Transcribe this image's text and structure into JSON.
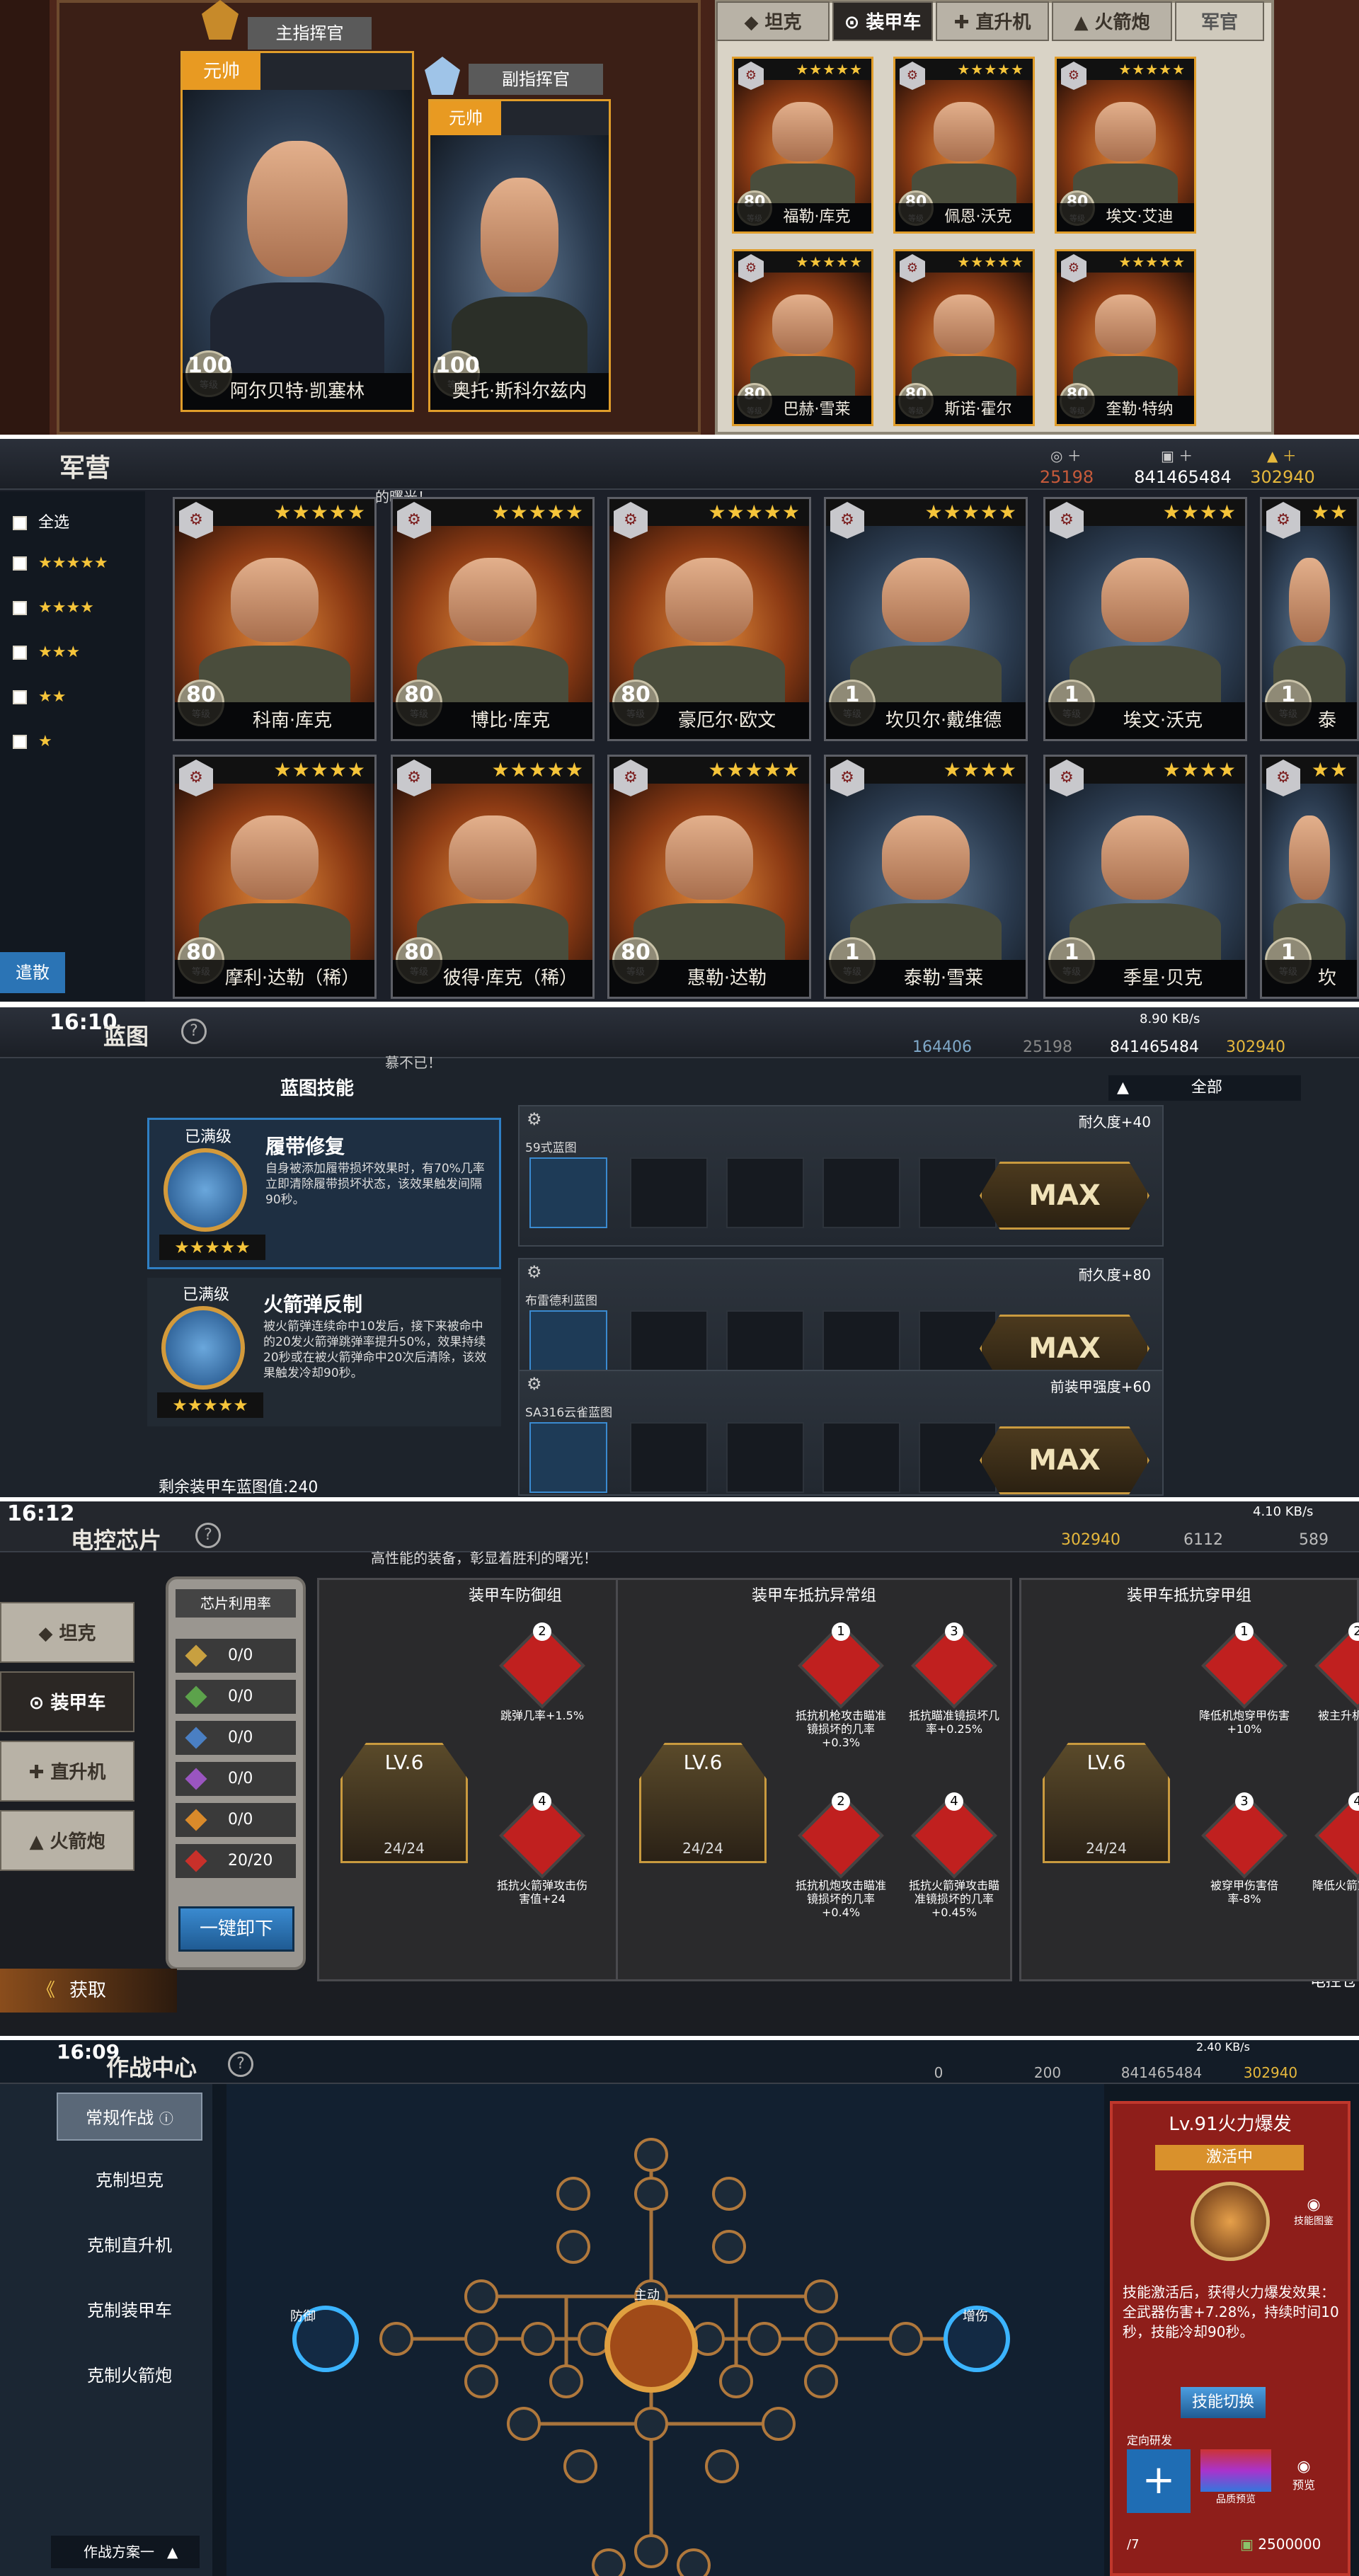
{
  "panel1": {
    "commander_label": "主指挥官",
    "vice_label": "副指挥官",
    "rank1": "元帅",
    "rank2": "元帅",
    "commander_name": "阿尔贝特·凯塞林",
    "vice_name": "奥托·斯科尔兹内",
    "commander_level": "100",
    "vice_level": "100",
    "level_unit": "等级",
    "tabs": [
      "坦克",
      "装甲车",
      "直升机",
      "火箭炮",
      "军官"
    ],
    "officers": [
      {
        "name": "福勒·库克",
        "level": "80"
      },
      {
        "name": "佩恩·沃克",
        "level": "80"
      },
      {
        "name": "埃文·艾迪",
        "level": "80"
      },
      {
        "name": "巴赫·雪莱",
        "level": "80"
      },
      {
        "name": "斯诺·霍尔",
        "level": "80"
      },
      {
        "name": "奎勒·特纳",
        "level": "80"
      }
    ]
  },
  "panel2": {
    "title": "军营",
    "res": [
      "25198",
      "841465484",
      "302940"
    ],
    "marquee": "…的曙光！",
    "filters": [
      "全选",
      "★★★★★",
      "★★★★",
      "★★★",
      "★★",
      "★"
    ],
    "dismiss": "遣散",
    "level_unit": "等级",
    "cards": [
      {
        "name": "科南·库克",
        "level": "80",
        "stars": "★★★★★"
      },
      {
        "name": "博比·库克",
        "level": "80",
        "stars": "★★★★★"
      },
      {
        "name": "豪厄尔·欧文",
        "level": "80",
        "stars": "★★★★★"
      },
      {
        "name": "坎贝尔·戴维德",
        "level": "1",
        "stars": "★★★★★"
      },
      {
        "name": "埃文·沃克",
        "level": "1",
        "stars": "★★★★"
      },
      {
        "name": "泰",
        "level": "1",
        "stars": "★★"
      },
      {
        "name": "摩利·达勒（稀）",
        "level": "80",
        "stars": "★★★★★"
      },
      {
        "name": "彼得·库克（稀）",
        "level": "80",
        "stars": "★★★★★"
      },
      {
        "name": "惠勒·达勒",
        "level": "80",
        "stars": "★★★★★"
      },
      {
        "name": "泰勒·雪莱",
        "level": "1",
        "stars": "★★★★"
      },
      {
        "name": "季星·贝克",
        "level": "1",
        "stars": "★★★★"
      },
      {
        "name": "坎",
        "level": "1",
        "stars": "★★"
      }
    ]
  },
  "panel3": {
    "time": "16:10",
    "title": "蓝图",
    "res": [
      "164406",
      "25198",
      "841465484",
      "302940"
    ],
    "net": "8.90 KB/s",
    "marquee": "慕不已！",
    "section": "蓝图技能",
    "filter_all": "全部",
    "skills": [
      {
        "status": "已满级",
        "name": "履带修复",
        "desc": "自身被添加履带损坏效果时，有70%几率立即清除履带损坏状态，该效果触发间隔90秒。",
        "stars": "★★★★★"
      },
      {
        "status": "已满级",
        "name": "火箭弹反制",
        "desc": "被火箭弹连续命中10发后，接下来被命中的20发火箭弹跳弹率提升50%，效果持续20秒或在被火箭弹命中20次后清除，该效果触发冷却90秒。",
        "stars": "★★★★★"
      }
    ],
    "remain": "剩余装甲车蓝图值:240",
    "rows": [
      {
        "bonus": "耐久度+40",
        "bp": "59式蓝图",
        "max": "MAX"
      },
      {
        "bonus": "耐久度+80",
        "bp": "布雷德利蓝图",
        "max": "MAX"
      },
      {
        "bonus": "前装甲强度+60",
        "bp": "SA316云雀蓝图",
        "max": "MAX"
      }
    ]
  },
  "panel4": {
    "time": "16:12",
    "title": "电控芯片",
    "res": [
      "302940",
      "6112",
      "589"
    ],
    "net": "4.10 KB/s",
    "marquee": "高性能的装备，彰显着胜利的曙光！",
    "side": [
      "坦克",
      "装甲车",
      "直升机",
      "火箭炮"
    ],
    "util_title": "芯片利用率",
    "util": [
      "0/0",
      "0/0",
      "0/0",
      "0/0",
      "0/0",
      "20/20"
    ],
    "unload": "一键卸下",
    "acquire": "获取",
    "warehouse": "电控仓",
    "groups": [
      {
        "title": "装甲车防御组",
        "lv": "LV.6",
        "count": "24/24",
        "nodes": [
          {
            "n": "2",
            "t": "跳弹几率+1.5%"
          },
          {
            "n": "4",
            "t": "抵抗火箭弹攻击伤害值+24"
          }
        ]
      },
      {
        "title": "装甲车抵抗异常组",
        "lv": "LV.6",
        "count": "24/24",
        "nodes": [
          {
            "n": "1",
            "t": "抵抗机枪攻击瞄准镜损坏的几率+0.3%"
          },
          {
            "n": "2",
            "t": "抵抗机炮攻击瞄准镜损坏的几率+0.4%"
          },
          {
            "n": "3",
            "t": "抵抗瞄准镜损坏几率+0.25%"
          },
          {
            "n": "4",
            "t": "抵抗火箭弹攻击瞄准镜损坏的几率+0.45%"
          }
        ]
      },
      {
        "title": "装甲车抵抗穿甲组",
        "lv": "LV.6",
        "count": "24/24",
        "nodes": [
          {
            "n": "1",
            "t": "降低机炮穿甲伤害+10%"
          },
          {
            "n": "3",
            "t": "被穿甲伤害倍率-8%"
          },
          {
            "n": "2",
            "t": "被主升机减伤率"
          },
          {
            "n": "4",
            "t": "降低火箭穿甲伤害"
          }
        ]
      }
    ]
  },
  "panel5": {
    "time": "16:09",
    "title": "作战中心",
    "res": [
      "0",
      "200",
      "841465484",
      "302940"
    ],
    "net": "2.40 KB/s",
    "menu": [
      "常规作战",
      "克制坦克",
      "克制直升机",
      "克制装甲车",
      "克制火箭炮"
    ],
    "plan": "作战方案一",
    "node_labels": {
      "left": "防御",
      "center": "主动",
      "right": "增伤"
    },
    "skill_title": "Lv.91火力爆发",
    "skill_state": "激活中",
    "skill_view": "技能图鉴",
    "skill_desc": "技能激活后，获得火力爆发效果：全武器伤害+7.28%，持续时间10秒，技能冷却90秒。",
    "switch": "技能切换",
    "research": "定向研发",
    "quality": "品质预览",
    "preview": "预览",
    "count": "/7",
    "money": "2500000"
  }
}
